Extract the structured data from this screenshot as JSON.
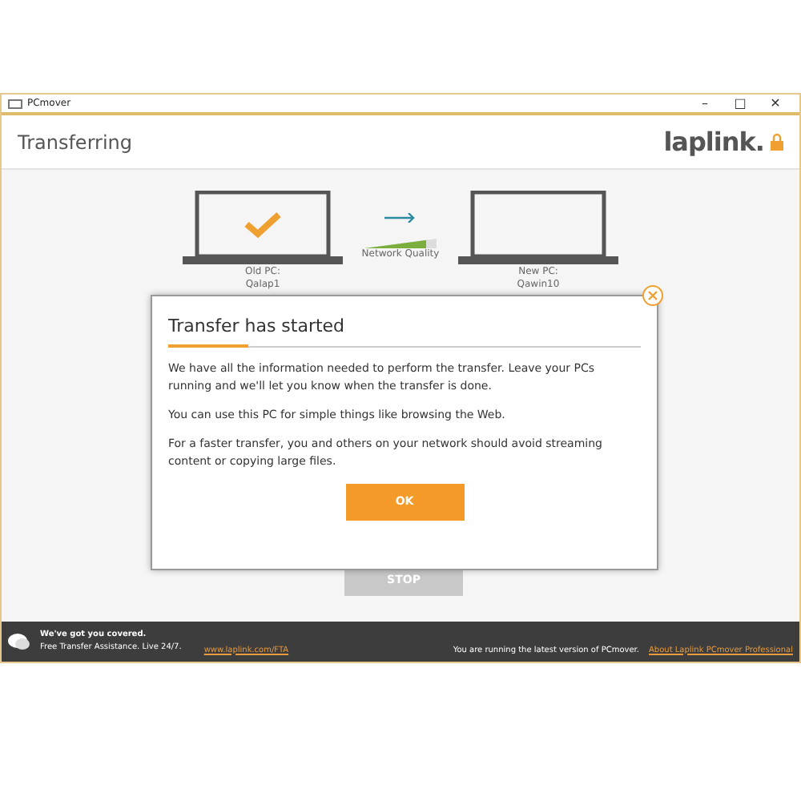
{
  "window": {
    "title": "PCmover",
    "controls": [
      "–",
      "□",
      "✕"
    ]
  },
  "header": {
    "title": "Transferring",
    "logo": "laplink."
  },
  "transfer": {
    "old_pc": {
      "label": "Old PC:",
      "name": "Qalap1",
      "checked": true
    },
    "network": {
      "label": "Network Quality",
      "level": 0.85
    },
    "new_pc": {
      "label": "New PC:",
      "name": "Qawin10",
      "checked": false
    },
    "stop_button": "STOP"
  },
  "dialog": {
    "title": "Transfer has started",
    "paragraphs": [
      "We have all the information needed to perform the transfer. Leave your PCs running and we'll let you know when the transfer is done.",
      "You can use this PC for simple things like browsing the Web.",
      "For a faster transfer, you and others on your network should avoid streaming content or copying large files."
    ],
    "ok_button": "OK"
  },
  "footer": {
    "headline": "We've got you covered.",
    "subline": "Free Transfer Assistance. Live 24/7.",
    "link": "www.laplink.com/FTA",
    "status": "You are running the latest version of PCmover.",
    "about_link": "About Laplink PCmover Professional"
  }
}
